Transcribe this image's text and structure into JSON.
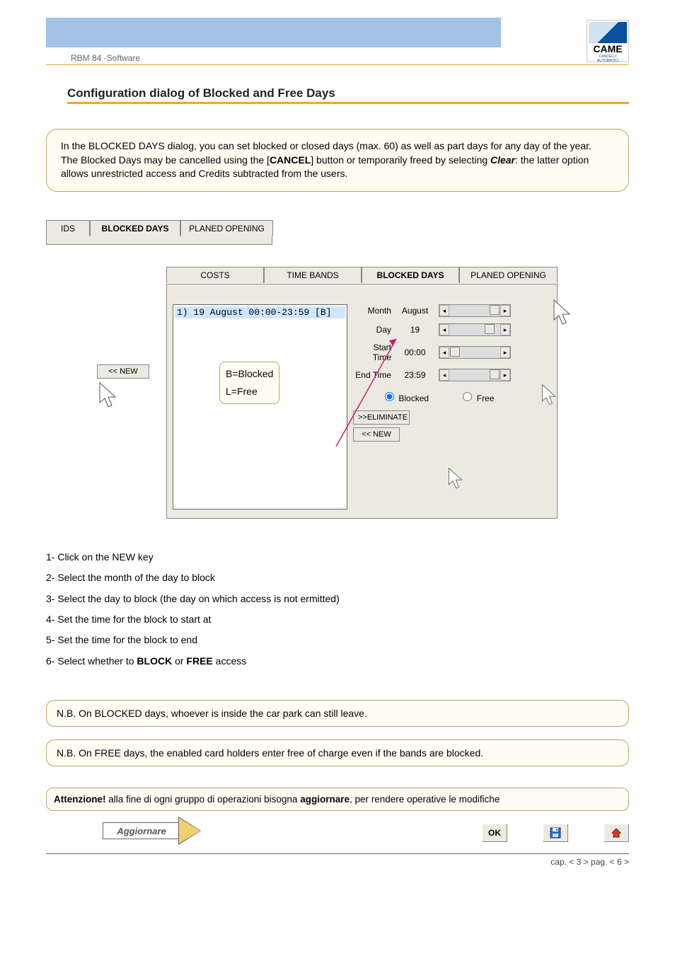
{
  "header": {
    "doc_title": "RBM 84 -Software"
  },
  "logo": {
    "brand": "CAME",
    "sub": "CANCELLI AUTOMATICI"
  },
  "section_title": "Configuration dialog of Blocked and Free Days",
  "intro": {
    "p1a": " In the BLOCKED DAYS dialog, you can set blocked or closed days (max. 60) as well as part days for any day of the year.",
    "p2a": "The Blocked Days may be cancelled using the [",
    "p2b": "CANCEL",
    "p2c": "] button or temporarily freed by selecting",
    "p2d": "Clear",
    "p2e": ": the latter option allows unrestricted access and Credits subtracted from the users."
  },
  "dlg1_tabs": {
    "t1": "IDS",
    "t2": "BLOCKED DAYS",
    "t3": "PLANED OPENING"
  },
  "dlg2_tabs": {
    "t1": "COSTS",
    "t2": "TIME BANDS",
    "t3": "BLOCKED DAYS",
    "t4": "PLANED OPENING"
  },
  "list_entry": "1) 19 August    00:00-23:59 [B]",
  "legend": {
    "l1": "B=Blocked",
    "l2": "L=Free"
  },
  "fields": {
    "month": {
      "label": "Month",
      "value": "August"
    },
    "day": {
      "label": "Day",
      "value": "19"
    },
    "start": {
      "label": "Start Time",
      "value": "00:00"
    },
    "end": {
      "label": "End Time",
      "value": "23:59"
    }
  },
  "radios": {
    "blocked": "Blocked",
    "free": "Free"
  },
  "buttons": {
    "new": "<< NEW",
    "eliminate": ">>ELIMINATE",
    "new2": "<< NEW"
  },
  "steps": {
    "s1": "1- Click on the NEW key",
    "s2": "2- Select the month of the day to block",
    "s3": "3- Select the day to block (the day on which access is not ermitted)",
    "s4": "4- Set the time for the block to start at",
    "s5": "5- Set the time for the block to end",
    "s6a": "6- Select whether to ",
    "s6b": "BLOCK",
    "s6c": " or ",
    "s6d": "FREE",
    "s6e": " access"
  },
  "note1": "N.B. On BLOCKED days, whoever is inside the car park can still leave.",
  "note2": "N.B. On FREE days, the enabled card holders enter free of charge even if the bands are blocked.",
  "warn": {
    "a": "Attenzione!",
    "b": " alla fine di ogni gruppo di operazioni bisogna ",
    "c": "aggiornare",
    "d": ", per rendere operative le modifiche"
  },
  "update_btn": "Aggiornare",
  "ok_btn": "OK",
  "footer": {
    "a": "cap. < ",
    "b": "3",
    "c": " > pag. < ",
    "d": "6",
    "e": " >"
  }
}
